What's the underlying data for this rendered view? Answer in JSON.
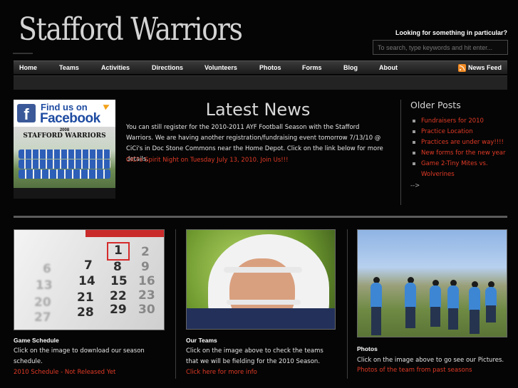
{
  "site": {
    "title": "Stafford Warriors"
  },
  "search": {
    "label": "Looking for something in particular?",
    "placeholder": "To search, type keywords and hit enter..."
  },
  "nav": {
    "items": [
      "Home",
      "Teams",
      "Activities",
      "Directions",
      "Volunteers",
      "Photos",
      "Forms",
      "Blog",
      "About"
    ],
    "feed_label": "News Feed",
    "feed_icon": "rss-feed-icon"
  },
  "promo": {
    "find_text": "Find us on",
    "brand_text": "Facebook",
    "year": "2008",
    "team_name": "STAFFORD WARRIORS"
  },
  "latest": {
    "title": "Latest News",
    "body": "You can still register for the 2010-2011 AYF Football Season with the Stafford Warriors. We are having another registration/fundraising event tomorrow 7/13/10 @ CiCi's in Doc Stone Commons near the Home Depot. Click on the link below for more details.",
    "link": "CiCi's Spirit Night on Tuesday July 13, 2010. Join Us!!!"
  },
  "older_posts": {
    "title": "Older Posts",
    "items": [
      "Fundraisers for 2010",
      "Practice Location",
      "Practices are under way!!!!",
      "New forms for the new year",
      "Game 2-Tiny Mites vs. Wolverines"
    ],
    "more": "-->"
  },
  "features": [
    {
      "title": "Game Schedule",
      "desc": "Click on the image to download our season schedule.",
      "link": "2010 Schedule - Not Released Yet"
    },
    {
      "title": "Our Teams",
      "desc": "Click on the image above to check the teams that we will be fielding for the 2010 Season.",
      "link": "Click here for more info"
    },
    {
      "title": "Photos",
      "desc": "Click on the image above to go see our Pictures.",
      "link": "Photos of the team from past seasons"
    }
  ],
  "calendar_numbers": [
    "1",
    "2",
    "7",
    "8",
    "9",
    "14",
    "15",
    "16",
    "21",
    "22",
    "23",
    "28",
    "29",
    "30",
    "6",
    "13",
    "20",
    "27"
  ],
  "colors": {
    "background": "#050505",
    "link": "#e23a26",
    "nav_gradient_top": "#3a3a3a",
    "facebook_blue": "#3b5998",
    "feed_orange": "#f08a24"
  }
}
